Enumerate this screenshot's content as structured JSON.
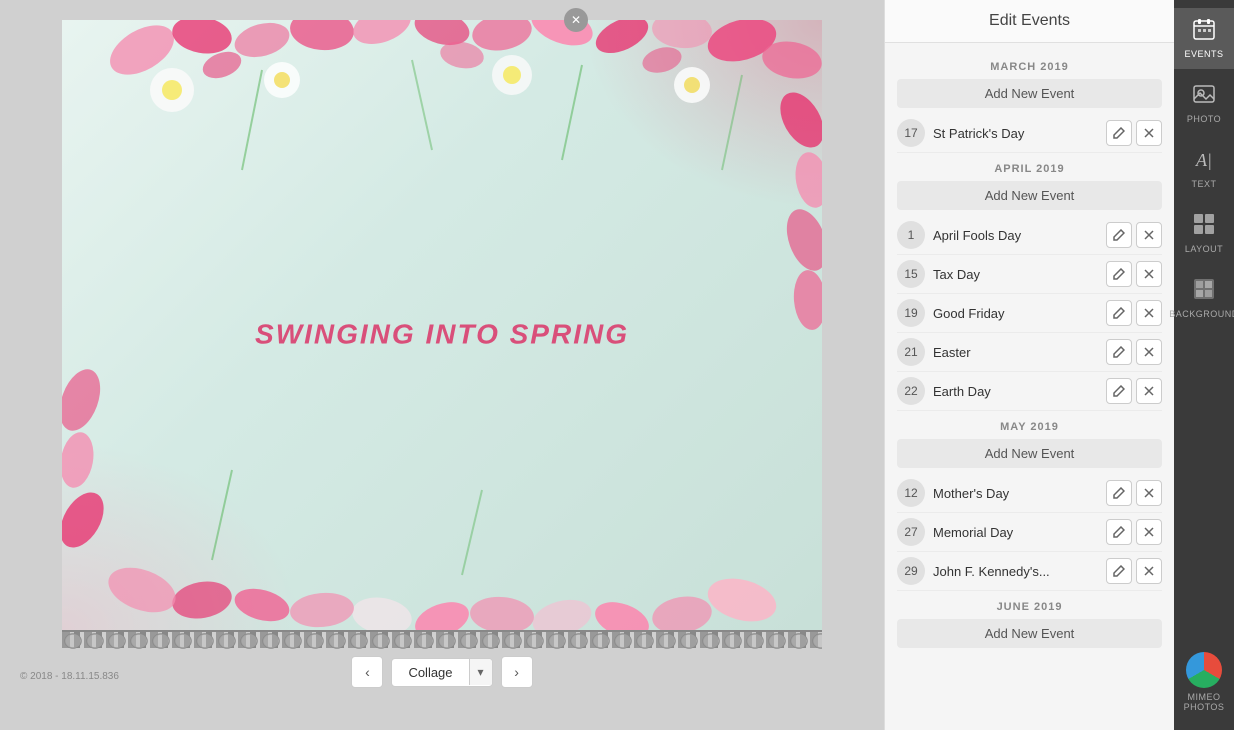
{
  "panel": {
    "title": "Edit Events",
    "close_icon": "✕"
  },
  "months": [
    {
      "id": "march-2019",
      "label": "MARCH 2019",
      "add_btn": "Add New Event",
      "events": [
        {
          "day": "17",
          "name": "St Patrick's Day"
        }
      ]
    },
    {
      "id": "april-2019",
      "label": "APRIL 2019",
      "add_btn": "Add New Event",
      "events": [
        {
          "day": "1",
          "name": "April Fools Day"
        },
        {
          "day": "15",
          "name": "Tax Day"
        },
        {
          "day": "19",
          "name": "Good Friday"
        },
        {
          "day": "21",
          "name": "Easter"
        },
        {
          "day": "22",
          "name": "Earth Day"
        }
      ]
    },
    {
      "id": "may-2019",
      "label": "MAY 2019",
      "add_btn": "Add New Event",
      "events": [
        {
          "day": "12",
          "name": "Mother's Day"
        },
        {
          "day": "27",
          "name": "Memorial Day"
        },
        {
          "day": "29",
          "name": "John F. Kennedy's..."
        }
      ]
    },
    {
      "id": "june-2019",
      "label": "JUNE 2019",
      "add_btn": "Add New Event",
      "events": []
    }
  ],
  "sidebar": {
    "items": [
      {
        "id": "events",
        "label": "EVENTS",
        "active": true
      },
      {
        "id": "photo",
        "label": "PHOTO",
        "active": false
      },
      {
        "id": "text",
        "label": "TEXT",
        "active": false
      },
      {
        "id": "layout",
        "label": "LAYOUT",
        "active": false
      },
      {
        "id": "background",
        "label": "BACKGROUND",
        "active": false
      }
    ],
    "logo_text": "mimeo",
    "logo_sub": "Photos"
  },
  "bottom": {
    "prev_label": "‹",
    "next_label": "›",
    "layout_label": "Collage",
    "layout_arrow": "▾"
  },
  "calendar": {
    "text": "Swinging into Spring"
  },
  "copyright": "© 2018 - 18.11.15.836"
}
